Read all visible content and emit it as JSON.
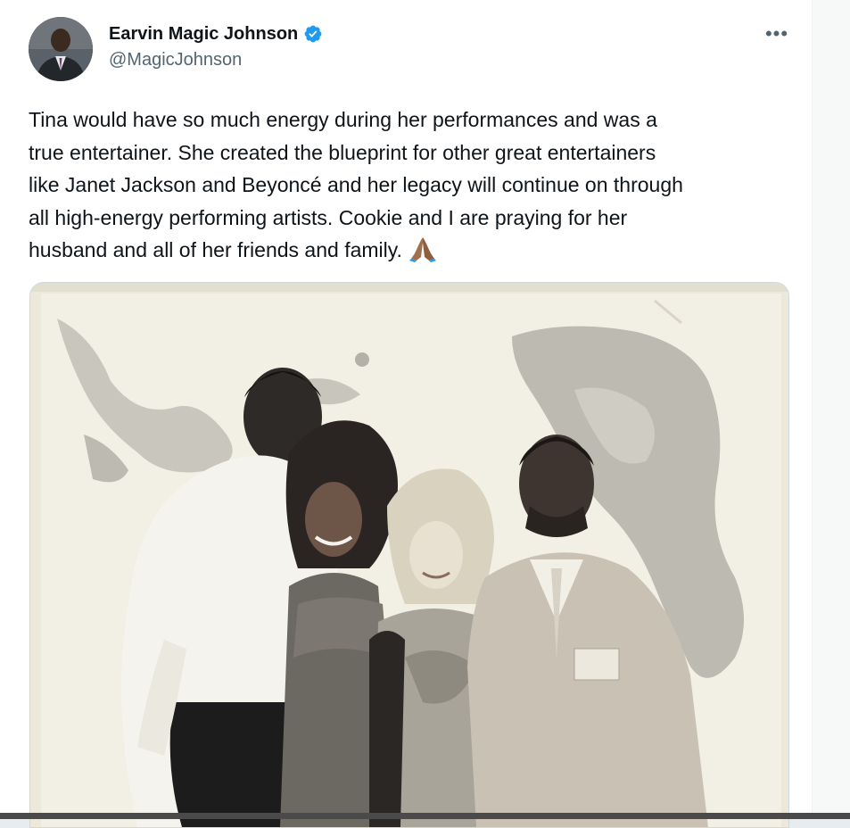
{
  "tweet": {
    "author": {
      "display_name": "Earvin Magic Johnson",
      "handle": "@MagicJohnson",
      "verified": true,
      "verified_color": "#1d9bf0"
    },
    "more_label": "•••",
    "text": "Tina would have so much energy during her performances and was a\ntrue entertainer. She created the blueprint for other great entertainers\nlike Janet Jackson and Beyoncé and her legacy will continue on through\nall high-energy performing artists. Cookie and I are praying for her\nhusband and all of her friends and family. ",
    "emoji": "folded-hands-medium-dark-skin"
  },
  "icons": {
    "verified": "verified-badge-icon",
    "more": "more-options-icon",
    "emoji": "folded-hands-icon"
  },
  "colors": {
    "text_primary": "#0f1419",
    "text_secondary": "#536471",
    "border": "#cfd9de",
    "background": "#ffffff"
  }
}
